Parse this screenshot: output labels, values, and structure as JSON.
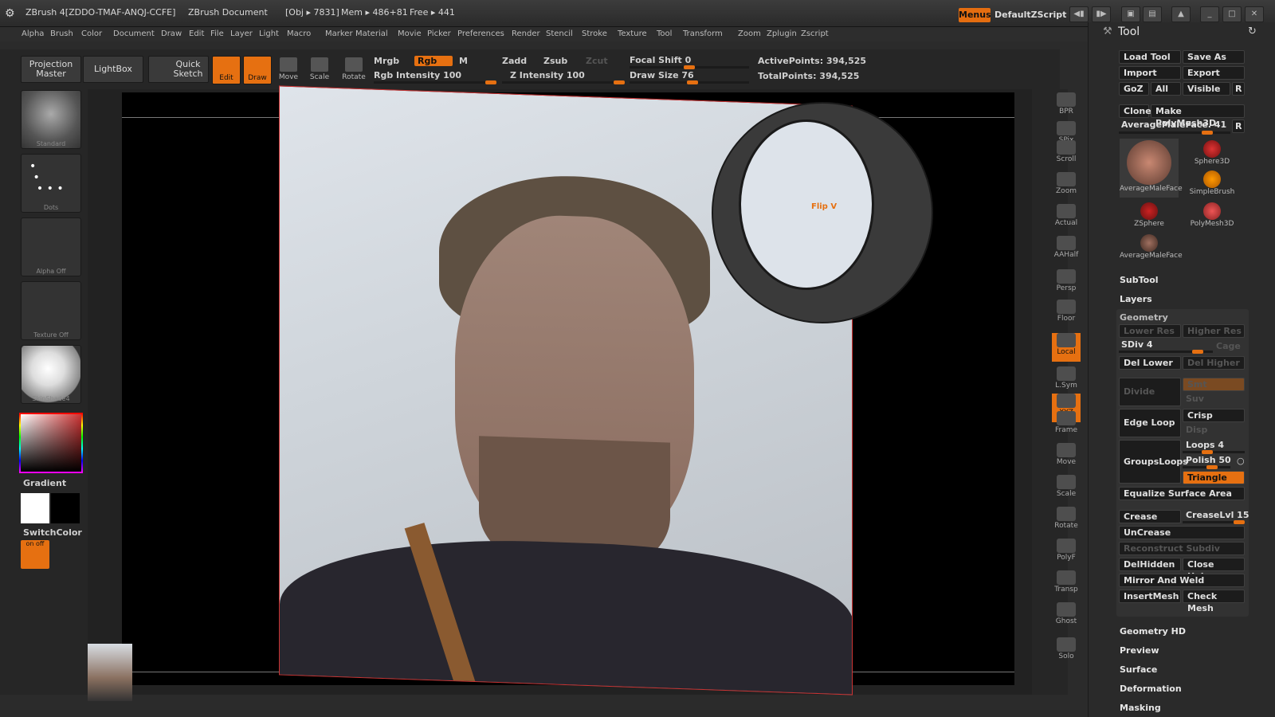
{
  "titlebar": {
    "app_title": "ZBrush 4[ZDDO-TMAF-ANQJ-CCFE]",
    "document": "ZBrush Document",
    "obj": "[Obj ▸ 7831]",
    "mem": "Mem ▸ 486+81",
    "free": "Free ▸ 441",
    "menus_label": "Menus",
    "script_label": "DefaultZScript"
  },
  "menubar": [
    "Alpha",
    "Brush",
    "Color",
    "Document",
    "Draw",
    "Edit",
    "File",
    "Layer",
    "Light",
    "Macro",
    "Marker",
    "Material",
    "Movie",
    "Picker",
    "Preferences",
    "Render",
    "Stencil",
    "Stroke",
    "Texture",
    "Tool",
    "Transform",
    "Zoom",
    "Zplugin",
    "Zscript"
  ],
  "toolbar": {
    "projection_master": "Projection Master",
    "lightbox": "LightBox",
    "quick_sketch": "Quick Sketch",
    "edit": "Edit",
    "draw": "Draw",
    "move": "Move",
    "scale": "Scale",
    "rotate": "Rotate",
    "mrgb": "Mrgb",
    "rgb": "Rgb",
    "m": "M",
    "rgb_intensity": "Rgb Intensity 100",
    "zadd": "Zadd",
    "zsub": "Zsub",
    "zcut": "Zcut",
    "z_intensity": "Z Intensity 100",
    "focal_shift": "Focal Shift 0",
    "draw_size": "Draw Size 76",
    "active_points": "ActivePoints: 394,525",
    "total_points": "TotalPoints: 394,525"
  },
  "leftshelf": {
    "brush": "Standard",
    "stroke": "Dots",
    "alpha": "Alpha Off",
    "texture": "Texture Off",
    "material": "SkinShade4",
    "gradient": "Gradient",
    "switchcolor": "SwitchColor",
    "onoff": "on off"
  },
  "canvas": {
    "flip_label": "Flip V"
  },
  "rightshelf": [
    "BPR",
    "SPix",
    "Scroll",
    "Zoom",
    "Actual",
    "AAHalf",
    "Persp",
    "Floor",
    "Local",
    "L.Sym",
    "XYZ",
    "Frame",
    "Move",
    "Scale",
    "Rotate",
    "PolyF",
    "Transp",
    "Ghost",
    "Solo"
  ],
  "toolpal": {
    "title": "Tool",
    "load_tool": "Load Tool",
    "save_as": "Save As",
    "import": "Import",
    "export": "Export",
    "goz": "GoZ",
    "all": "All",
    "visible": "Visible",
    "r": "R",
    "clone": "Clone",
    "make_polymesh": "Make PolyMesh3D",
    "current_tool": "AverageMaleFace. 41",
    "tools": [
      "AverageMaleFace",
      "Sphere3D",
      "SimpleBrush",
      "ZSphere",
      "PolyMesh3D",
      "AverageMaleFace"
    ],
    "subtool": "SubTool",
    "layers": "Layers",
    "geometry": "Geometry",
    "lower_res": "Lower Res",
    "higher_res": "Higher Res",
    "sdiv": "SDiv 4",
    "cage": "Cage",
    "del_lower": "Del Lower",
    "del_higher": "Del Higher",
    "divide": "Divide",
    "smt": "Smt",
    "suv": "Suv",
    "edge_loop": "Edge Loop",
    "crisp": "Crisp",
    "disp": "Disp",
    "groupsloops": "GroupsLoops",
    "loops": "Loops 4",
    "polish": "Polish 50",
    "triangle": "Triangle",
    "equalize": "Equalize Surface Area",
    "crease": "Crease",
    "creaselvl": "CreaseLvl 15",
    "uncrease": "UnCrease",
    "reconstruct": "Reconstruct Subdiv",
    "delhidden": "DelHidden",
    "close_holes": "Close Holes",
    "mirror_weld": "Mirror And Weld",
    "insertmesh": "InsertMesh",
    "check_mesh": "Check Mesh",
    "geometry_hd": "Geometry HD",
    "preview": "Preview",
    "surface": "Surface",
    "deformation": "Deformation",
    "masking": "Masking"
  },
  "colors": {
    "accent": "#e67011",
    "bg": "#2b2b2b"
  }
}
